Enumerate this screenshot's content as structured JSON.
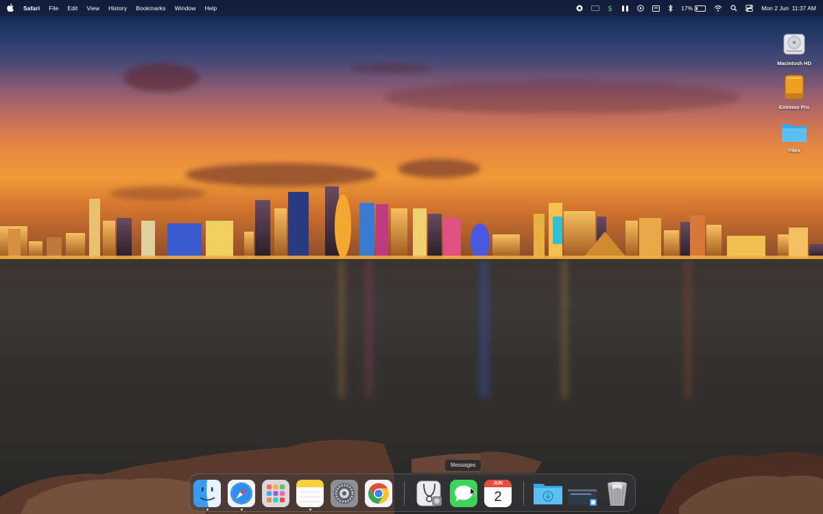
{
  "menubar": {
    "apple_glyph": "",
    "app_name": "Safari",
    "menus": [
      "File",
      "Edit",
      "View",
      "History",
      "Bookmarks",
      "Window",
      "Help"
    ],
    "status": {
      "battery_percent": "17%",
      "battery_level": 0.17,
      "datetime": "Mon 2 Jun  11:37 AM"
    }
  },
  "desktop_icons": [
    {
      "label": "Macintosh HD",
      "icon": "hard-drive-icon"
    },
    {
      "label": "Extreme Pro",
      "icon": "external-drive-icon"
    },
    {
      "label": "Files",
      "icon": "folder-icon"
    }
  ],
  "dock": {
    "tooltip": "Messages",
    "items": [
      {
        "name": "Finder",
        "icon": "finder-icon",
        "running": true
      },
      {
        "name": "Safari",
        "icon": "safari-icon",
        "running": true
      },
      {
        "name": "Launchpad",
        "icon": "launchpad-icon",
        "running": false
      },
      {
        "name": "Notes",
        "icon": "notes-icon",
        "running": true
      },
      {
        "name": "System Settings",
        "icon": "settings-icon",
        "running": false
      },
      {
        "name": "Chrome",
        "icon": "chrome-icon",
        "running": false
      },
      {
        "name": "Disk Utility",
        "icon": "disk-utility-icon",
        "running": false
      },
      {
        "name": "Messages",
        "icon": "messages-icon",
        "running": false
      },
      {
        "name": "Calendar",
        "icon": "calendar-icon",
        "running": true,
        "month": "JUN",
        "day": "2"
      },
      {
        "name": "Downloads",
        "icon": "downloads-folder-icon",
        "running": false
      },
      {
        "name": "Recent",
        "icon": "stack-icon",
        "running": false
      },
      {
        "name": "Trash",
        "icon": "trash-icon",
        "running": false
      }
    ]
  },
  "colors": {
    "accent_blue": "#3aa3f0",
    "folder_blue": "#5cc0f2",
    "drive_orange": "#f0a020"
  }
}
